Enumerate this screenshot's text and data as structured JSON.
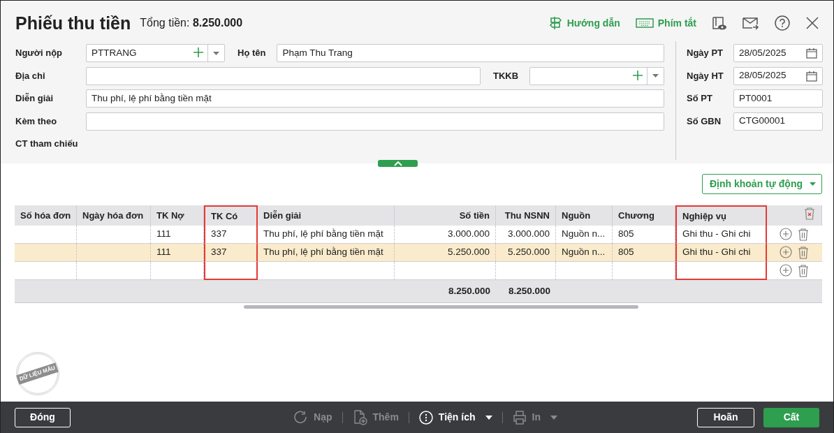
{
  "window": {
    "title": "Phiếu thu tiền",
    "total_label": "Tổng tiền:",
    "total_value": "8.250.000"
  },
  "header_links": [
    {
      "label": "Hướng dẫn",
      "kind": "guide"
    },
    {
      "label": "Phím tắt",
      "kind": "keyboard"
    }
  ],
  "form": {
    "rows": [
      {
        "fields": [
          {
            "label": "Người nộp",
            "value": "PTTRANG",
            "kind": "combo"
          },
          {
            "label": "Họ tên",
            "value": "Phạm Thu Trang",
            "kind": "text"
          }
        ]
      },
      {
        "fields": [
          {
            "label": "Địa chỉ",
            "kind": "text"
          },
          {
            "label": "TKKB",
            "kind": "combo"
          }
        ]
      },
      {
        "fields": [
          {
            "label": "Diễn giải",
            "value": "Thu phí, lệ phí bằng tiền mặt",
            "kind": "text"
          }
        ]
      },
      {
        "fields": [
          {
            "label": "Kèm theo",
            "kind": "text"
          }
        ]
      },
      {
        "fields": [
          {
            "label": "CT tham chiếu",
            "kind": "label"
          }
        ]
      }
    ],
    "right": [
      {
        "label": "Ngày PT",
        "value": "28/05/2025",
        "kind": "date"
      },
      {
        "label": "Ngày HT",
        "value": "28/05/2025",
        "kind": "date"
      },
      {
        "label": "Số PT",
        "value": "PT0001",
        "kind": "text"
      },
      {
        "label": "Số GBN",
        "value": "CTG00001",
        "kind": "text"
      }
    ]
  },
  "auto_button": {
    "label": "Định khoản tự động"
  },
  "table": {
    "columns": [
      {
        "label": "Số hóa đơn",
        "kind": "text",
        "highlighted": false
      },
      {
        "label": "Ngày hóa đơn",
        "kind": "text",
        "highlighted": false
      },
      {
        "label": "TK Nợ",
        "kind": "text",
        "highlighted": false
      },
      {
        "label": "TK Có",
        "kind": "text",
        "highlighted": true
      },
      {
        "label": "Diễn giải",
        "kind": "text",
        "highlighted": false
      },
      {
        "label": "Số tiền",
        "kind": "amount",
        "highlighted": false,
        "total": "8.250.000"
      },
      {
        "label": "Thu NSNN",
        "kind": "amount",
        "highlighted": false,
        "total": "8.250.000"
      },
      {
        "label": "Nguồn",
        "kind": "text",
        "highlighted": false
      },
      {
        "label": "Chương",
        "kind": "text",
        "highlighted": false
      },
      {
        "label": "Nghiệp vụ",
        "kind": "text",
        "highlighted": true
      }
    ],
    "rows": [
      {
        "selected": false,
        "cells": [
          "",
          "",
          "111",
          "337",
          "Thu phí, lệ phí bằng tiền mặt",
          "3.000.000",
          "3.000.000",
          "Nguồn n...",
          "805",
          "Ghi thu - Ghi chi"
        ]
      },
      {
        "selected": true,
        "cells": [
          "",
          "",
          "111",
          "337",
          "Thu phí, lệ phí bằng tiền mặt",
          "5.250.000",
          "5.250.000",
          "Nguồn n...",
          "805",
          "Ghi thu - Ghi chi"
        ]
      },
      {
        "selected": false
      }
    ]
  },
  "stamp": {
    "text": "DỮ LIỆU MẪU"
  },
  "footer": {
    "close": "Đóng",
    "tools": [
      {
        "label": "Nạp",
        "kind": "reload",
        "disabled": true,
        "dropdown": false
      },
      {
        "label": "Thêm",
        "kind": "add",
        "disabled": true,
        "dropdown": false
      },
      {
        "label": "Tiện ích",
        "kind": "utility",
        "disabled": false,
        "dropdown": true
      },
      {
        "label": "In",
        "kind": "print",
        "disabled": true,
        "dropdown": true
      }
    ],
    "cancel": "Hoãn",
    "save": "Cất"
  }
}
